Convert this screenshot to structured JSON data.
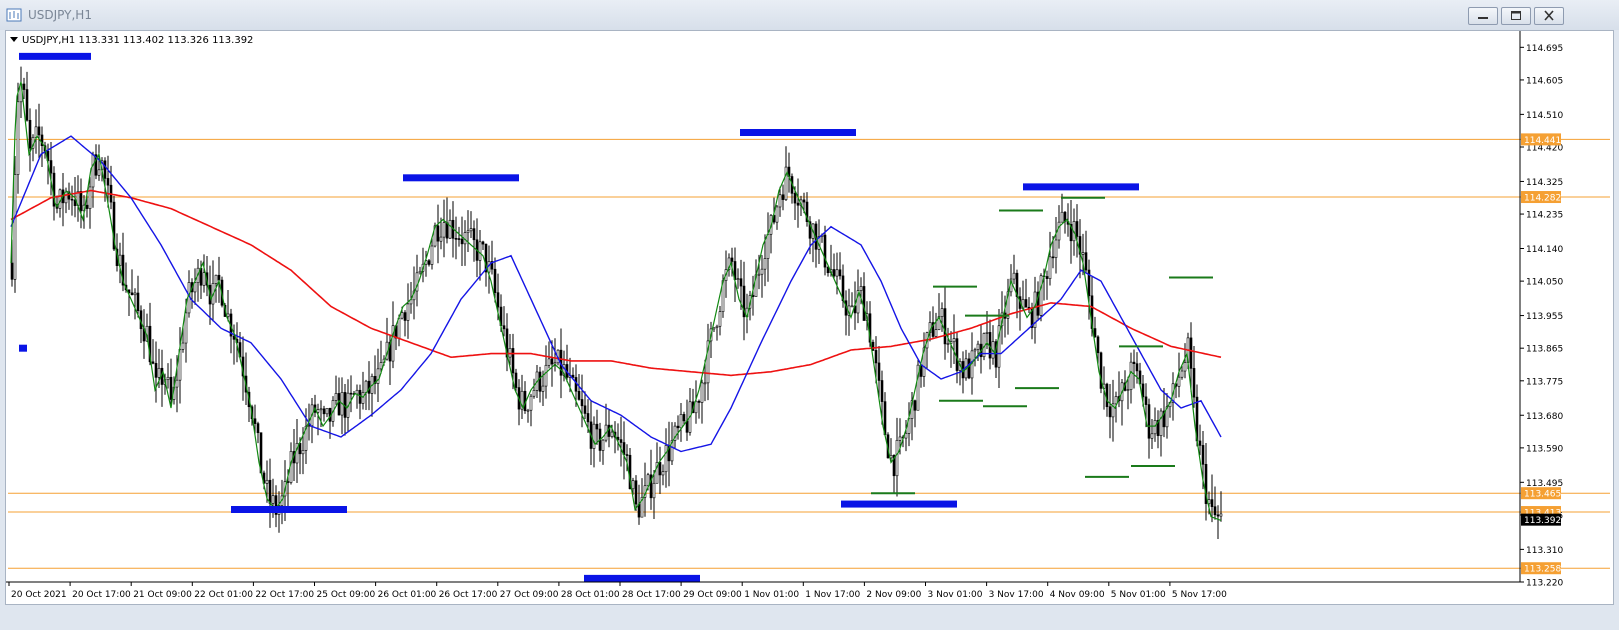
{
  "window": {
    "title": "USDJPY,H1"
  },
  "chart_data": {
    "type": "candlestick",
    "symbol_line": "USDJPY,H1  113.331 113.402 113.326 113.392",
    "ylim": [
      113.22,
      114.74
    ],
    "price_ticks": [
      "114.695",
      "114.605",
      "114.510",
      "114.420",
      "114.325",
      "114.235",
      "114.140",
      "114.050",
      "113.955",
      "113.865",
      "113.775",
      "113.680",
      "113.590",
      "113.495",
      "113.405",
      "113.310",
      "113.220"
    ],
    "time_ticks": [
      "20 Oct 2021",
      "20 Oct 17:00",
      "21 Oct 09:00",
      "22 Oct 01:00",
      "22 Oct 17:00",
      "25 Oct 09:00",
      "26 Oct 01:00",
      "26 Oct 17:00",
      "27 Oct 09:00",
      "28 Oct 01:00",
      "28 Oct 17:00",
      "29 Oct 09:00",
      "1 Nov 01:00",
      "1 Nov 17:00",
      "2 Nov 09:00",
      "3 Nov 01:00",
      "3 Nov 17:00",
      "4 Nov 09:00",
      "5 Nov 01:00",
      "5 Nov 17:00"
    ],
    "horizontal_levels": [
      {
        "price": 114.441,
        "label": "114.441"
      },
      {
        "price": 114.282,
        "label": "114.282"
      },
      {
        "price": 113.465,
        "label": "113.465"
      },
      {
        "price": 113.413,
        "label": "113.413"
      },
      {
        "price": 113.258,
        "label": "113.258"
      }
    ],
    "current_price": {
      "price": 113.392,
      "label": "113.392"
    },
    "close_path": [
      [
        0,
        114.1
      ],
      [
        5,
        114.55
      ],
      [
        10,
        114.6
      ],
      [
        18,
        114.4
      ],
      [
        26,
        114.45
      ],
      [
        34,
        114.42
      ],
      [
        45,
        114.25
      ],
      [
        55,
        114.3
      ],
      [
        64,
        114.28
      ],
      [
        72,
        114.22
      ],
      [
        80,
        114.36
      ],
      [
        88,
        114.4
      ],
      [
        96,
        114.28
      ],
      [
        104,
        114.15
      ],
      [
        112,
        114.05
      ],
      [
        120,
        114.0
      ],
      [
        128,
        113.95
      ],
      [
        136,
        113.9
      ],
      [
        144,
        113.75
      ],
      [
        152,
        113.8
      ],
      [
        160,
        113.7
      ],
      [
        168,
        113.85
      ],
      [
        176,
        114.0
      ],
      [
        184,
        114.05
      ],
      [
        192,
        114.1
      ],
      [
        200,
        114.0
      ],
      [
        208,
        114.05
      ],
      [
        216,
        113.95
      ],
      [
        224,
        113.9
      ],
      [
        232,
        113.8
      ],
      [
        240,
        113.7
      ],
      [
        248,
        113.55
      ],
      [
        256,
        113.45
      ],
      [
        264,
        113.42
      ],
      [
        272,
        113.45
      ],
      [
        280,
        113.55
      ],
      [
        288,
        113.6
      ],
      [
        296,
        113.65
      ],
      [
        304,
        113.7
      ],
      [
        312,
        113.65
      ],
      [
        320,
        113.68
      ],
      [
        328,
        113.72
      ],
      [
        336,
        113.7
      ],
      [
        344,
        113.74
      ],
      [
        352,
        113.73
      ],
      [
        360,
        113.76
      ],
      [
        368,
        113.78
      ],
      [
        376,
        113.85
      ],
      [
        384,
        113.92
      ],
      [
        392,
        113.98
      ],
      [
        400,
        114.0
      ],
      [
        408,
        114.05
      ],
      [
        416,
        114.12
      ],
      [
        424,
        114.2
      ],
      [
        432,
        114.22
      ],
      [
        440,
        114.2
      ],
      [
        448,
        114.18
      ],
      [
        456,
        114.16
      ],
      [
        464,
        114.14
      ],
      [
        472,
        114.12
      ],
      [
        480,
        114.05
      ],
      [
        488,
        113.95
      ],
      [
        496,
        113.85
      ],
      [
        504,
        113.75
      ],
      [
        512,
        113.7
      ],
      [
        520,
        113.75
      ],
      [
        528,
        113.78
      ],
      [
        536,
        113.8
      ],
      [
        544,
        113.82
      ],
      [
        552,
        113.8
      ],
      [
        560,
        113.75
      ],
      [
        568,
        113.7
      ],
      [
        576,
        113.65
      ],
      [
        584,
        113.6
      ],
      [
        592,
        113.62
      ],
      [
        600,
        113.65
      ],
      [
        608,
        113.6
      ],
      [
        616,
        113.55
      ],
      [
        624,
        113.42
      ],
      [
        632,
        113.45
      ],
      [
        640,
        113.5
      ],
      [
        648,
        113.55
      ],
      [
        656,
        113.58
      ],
      [
        664,
        113.62
      ],
      [
        672,
        113.65
      ],
      [
        680,
        113.68
      ],
      [
        688,
        113.75
      ],
      [
        696,
        113.85
      ],
      [
        704,
        113.95
      ],
      [
        712,
        114.05
      ],
      [
        720,
        114.1
      ],
      [
        728,
        114.0
      ],
      [
        736,
        113.95
      ],
      [
        744,
        114.05
      ],
      [
        752,
        114.15
      ],
      [
        760,
        114.2
      ],
      [
        768,
        114.3
      ],
      [
        776,
        114.35
      ],
      [
        784,
        114.3
      ],
      [
        792,
        114.25
      ],
      [
        800,
        114.2
      ],
      [
        808,
        114.15
      ],
      [
        816,
        114.1
      ],
      [
        824,
        114.05
      ],
      [
        832,
        114.0
      ],
      [
        840,
        113.95
      ],
      [
        848,
        114.02
      ],
      [
        856,
        113.95
      ],
      [
        864,
        113.8
      ],
      [
        872,
        113.65
      ],
      [
        880,
        113.55
      ],
      [
        888,
        113.58
      ],
      [
        896,
        113.65
      ],
      [
        904,
        113.75
      ],
      [
        912,
        113.85
      ],
      [
        920,
        113.92
      ],
      [
        928,
        113.95
      ],
      [
        936,
        113.9
      ],
      [
        944,
        113.85
      ],
      [
        952,
        113.8
      ],
      [
        960,
        113.82
      ],
      [
        968,
        113.85
      ],
      [
        976,
        113.88
      ],
      [
        984,
        113.85
      ],
      [
        992,
        113.95
      ],
      [
        1000,
        114.05
      ],
      [
        1008,
        114.0
      ],
      [
        1016,
        113.95
      ],
      [
        1024,
        113.98
      ],
      [
        1032,
        114.05
      ],
      [
        1040,
        114.15
      ],
      [
        1048,
        114.2
      ],
      [
        1056,
        114.22
      ],
      [
        1064,
        114.18
      ],
      [
        1072,
        114.1
      ],
      [
        1080,
        113.95
      ],
      [
        1088,
        113.8
      ],
      [
        1096,
        113.72
      ],
      [
        1104,
        113.7
      ],
      [
        1112,
        113.75
      ],
      [
        1120,
        113.8
      ],
      [
        1128,
        113.78
      ],
      [
        1136,
        113.65
      ],
      [
        1144,
        113.65
      ],
      [
        1152,
        113.68
      ],
      [
        1160,
        113.72
      ],
      [
        1168,
        113.8
      ],
      [
        1176,
        113.85
      ],
      [
        1184,
        113.65
      ],
      [
        1192,
        113.5
      ],
      [
        1200,
        113.4
      ],
      [
        1210,
        113.39
      ]
    ],
    "blue_ma_path": [
      [
        0,
        114.2
      ],
      [
        30,
        114.4
      ],
      [
        60,
        114.45
      ],
      [
        90,
        114.38
      ],
      [
        120,
        114.28
      ],
      [
        150,
        114.15
      ],
      [
        180,
        114.0
      ],
      [
        210,
        113.92
      ],
      [
        240,
        113.88
      ],
      [
        270,
        113.78
      ],
      [
        300,
        113.65
      ],
      [
        330,
        113.62
      ],
      [
        360,
        113.68
      ],
      [
        390,
        113.75
      ],
      [
        420,
        113.85
      ],
      [
        450,
        114.0
      ],
      [
        480,
        114.1
      ],
      [
        500,
        114.12
      ],
      [
        520,
        114.0
      ],
      [
        550,
        113.82
      ],
      [
        580,
        113.72
      ],
      [
        610,
        113.68
      ],
      [
        640,
        113.62
      ],
      [
        670,
        113.58
      ],
      [
        700,
        113.6
      ],
      [
        720,
        113.7
      ],
      [
        750,
        113.88
      ],
      [
        780,
        114.05
      ],
      [
        800,
        114.15
      ],
      [
        820,
        114.2
      ],
      [
        850,
        114.15
      ],
      [
        870,
        114.05
      ],
      [
        890,
        113.92
      ],
      [
        910,
        113.82
      ],
      [
        930,
        113.78
      ],
      [
        950,
        113.8
      ],
      [
        970,
        113.85
      ],
      [
        990,
        113.85
      ],
      [
        1010,
        113.9
      ],
      [
        1030,
        113.95
      ],
      [
        1050,
        114.0
      ],
      [
        1070,
        114.08
      ],
      [
        1090,
        114.05
      ],
      [
        1110,
        113.95
      ],
      [
        1130,
        113.85
      ],
      [
        1150,
        113.75
      ],
      [
        1170,
        113.7
      ],
      [
        1190,
        113.72
      ],
      [
        1210,
        113.62
      ]
    ],
    "red_ma_path": [
      [
        0,
        114.22
      ],
      [
        40,
        114.28
      ],
      [
        80,
        114.3
      ],
      [
        120,
        114.28
      ],
      [
        160,
        114.25
      ],
      [
        200,
        114.2
      ],
      [
        240,
        114.15
      ],
      [
        280,
        114.08
      ],
      [
        320,
        113.98
      ],
      [
        360,
        113.92
      ],
      [
        400,
        113.88
      ],
      [
        440,
        113.84
      ],
      [
        480,
        113.85
      ],
      [
        520,
        113.85
      ],
      [
        560,
        113.83
      ],
      [
        600,
        113.83
      ],
      [
        640,
        113.81
      ],
      [
        680,
        113.8
      ],
      [
        720,
        113.79
      ],
      [
        760,
        113.8
      ],
      [
        800,
        113.82
      ],
      [
        840,
        113.86
      ],
      [
        880,
        113.87
      ],
      [
        920,
        113.89
      ],
      [
        960,
        113.92
      ],
      [
        1000,
        113.96
      ],
      [
        1040,
        113.99
      ],
      [
        1080,
        113.98
      ],
      [
        1120,
        113.92
      ],
      [
        1160,
        113.87
      ],
      [
        1210,
        113.84
      ]
    ],
    "blue_zones": [
      {
        "x1": 8,
        "x2": 80,
        "price": 114.67
      },
      {
        "x1": 220,
        "x2": 336,
        "price": 113.42
      },
      {
        "x1": 392,
        "x2": 508,
        "price": 114.335
      },
      {
        "x1": 573,
        "x2": 689,
        "price": 113.23
      },
      {
        "x1": 729,
        "x2": 845,
        "price": 114.46
      },
      {
        "x1": 830,
        "x2": 946,
        "price": 113.435
      },
      {
        "x1": 1012,
        "x2": 1128,
        "price": 114.31
      },
      {
        "x1": 8,
        "x2": 16,
        "price": 113.865
      }
    ],
    "green_levels": [
      {
        "x1": 860,
        "x2": 904,
        "price": 113.465
      },
      {
        "x1": 922,
        "x2": 966,
        "price": 114.035
      },
      {
        "x1": 928,
        "x2": 972,
        "price": 113.72
      },
      {
        "x1": 954,
        "x2": 998,
        "price": 113.955
      },
      {
        "x1": 972,
        "x2": 1016,
        "price": 113.705
      },
      {
        "x1": 988,
        "x2": 1032,
        "price": 114.245
      },
      {
        "x1": 1004,
        "x2": 1048,
        "price": 113.755
      },
      {
        "x1": 1050,
        "x2": 1094,
        "price": 114.28
      },
      {
        "x1": 1074,
        "x2": 1118,
        "price": 113.51
      },
      {
        "x1": 1108,
        "x2": 1152,
        "price": 113.87
      },
      {
        "x1": 1120,
        "x2": 1164,
        "price": 113.54
      },
      {
        "x1": 1158,
        "x2": 1202,
        "price": 114.06
      }
    ]
  }
}
